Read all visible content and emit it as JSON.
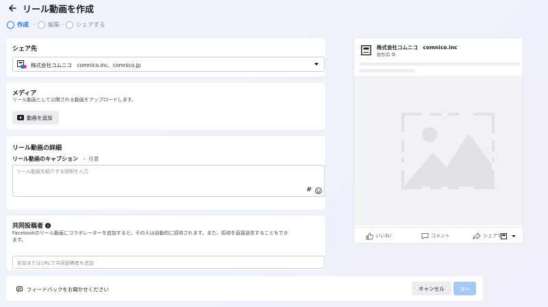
{
  "header": {
    "title": "リール動画を作成",
    "back_icon": "arrow-left-icon"
  },
  "stepper": {
    "steps": [
      {
        "label": "作成",
        "active": true
      },
      {
        "label": "編集",
        "active": false
      },
      {
        "label": "シェアする",
        "active": false
      }
    ]
  },
  "share": {
    "title": "シェア先",
    "page_name": "株式会社コムニコ　comnico.inc、comnico.jp",
    "avatar_icon": "page-avatar-icon"
  },
  "media": {
    "title": "メディア",
    "description": "リール動画として公開される動画をアップロードします。",
    "add_video_label": "動画を追加",
    "add_video_icon": "video-icon"
  },
  "details": {
    "title": "リール動画の詳細",
    "caption_label": "リール動画のキャプション",
    "caption_optional": "・ 任意",
    "caption_placeholder": "リール動画を紹介する説明を入力",
    "hashtag_symbol": "#",
    "emoji_icon": "emoji-icon"
  },
  "collaborator": {
    "title": "共同投稿者",
    "info_icon": "info-icon",
    "description": "Facebookのリール動画にコラボレーターを追加すると、その人は自動的に招待されます。また、招待を直接送信することもでき",
    "description_tail": "ます。",
    "input_placeholder": "名前またはURLで共同投稿者を追加"
  },
  "footer": {
    "feedback_label": "フィードバックをお聞かせください",
    "feedback_icon": "feedback-icon",
    "cancel_label": "キャンセル",
    "next_label": "次へ"
  },
  "preview": {
    "page_name": "株式会社コムニコ　comnico.inc",
    "time": "数秒前",
    "privacy_icon": "globe-icon",
    "image_placeholder_icon": "image-placeholder-icon",
    "actions": [
      {
        "label": "いいね！",
        "icon": "like-icon"
      },
      {
        "label": "コメント",
        "icon": "comment-icon"
      },
      {
        "label": "シェアする",
        "icon": "share-icon"
      }
    ],
    "audience_icon": "page-avatar-icon"
  },
  "colors": {
    "accent": "#1b74e4",
    "next_disabled": "#a6c8f5",
    "placeholder": "#e4e6eb"
  }
}
